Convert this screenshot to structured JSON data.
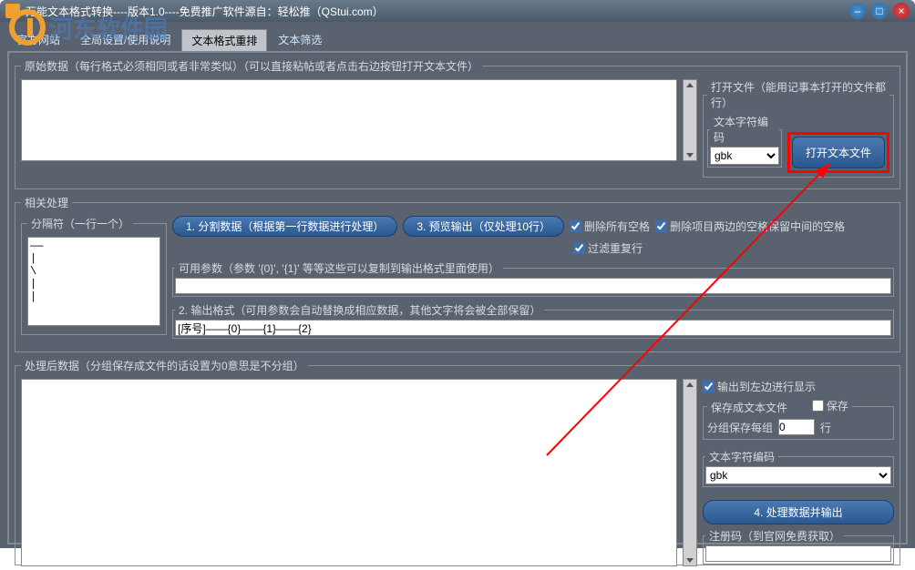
{
  "window": {
    "title": "万能文本格式转换----版本1.0----免费推广软件源自：轻松推（QStui.com）"
  },
  "watermark": "河东软件园",
  "tabs": {
    "t1": "官方网站",
    "t2": "全局设置/使用说明",
    "t3": "文本格式重排",
    "t4": "文本筛选"
  },
  "section1": {
    "legend": "原始数据（每行格式必须相同或者非常类似）（可以直接粘帖或者点击右边按钮打开文本文件）",
    "openfile_legend": "打开文件（能用记事本打开的文件都行）",
    "encoding_label": "文本字符编码",
    "encoding_value": "gbk",
    "open_btn": "打开文本文件"
  },
  "section2": {
    "legend": "相关处理",
    "separator_legend": "分隔符（一行一个）",
    "separator_text": "——\n|\n\\\n|\n|",
    "btn_split": "1. 分割数据（根据第一行数据进行处理）",
    "btn_preview": "3. 预览输出（仅处理10行）",
    "chk_remove_spaces": "删除所有空格",
    "chk_trim_spaces": "删除项目两边的空格保留中间的空格",
    "chk_dedupe": "过滤重复行",
    "params_legend": "可用参数（参数 '{0}', '{1}' 等等这些可以复制到输出格式里面使用）",
    "format_legend": "2. 输出格式（可用参数会自动替换成相应数据，其他文字将会被全部保留）",
    "format_value": "[序号]——{0}——{1}——{2}"
  },
  "section3": {
    "legend": "处理后数据（分组保存成文件的话设置为0意思是不分组）",
    "chk_output_left": "输出到左边进行显示",
    "save_legend": "保存成文本文件",
    "chk_save": "保存",
    "groups_label": "分组保存每组",
    "groups_value": "0",
    "groups_unit": "行",
    "encoding_label": "文本字符编码",
    "encoding_value": "gbk",
    "btn_process": "4. 处理数据并输出",
    "reg_legend": "注册码（到官网免费获取）"
  }
}
